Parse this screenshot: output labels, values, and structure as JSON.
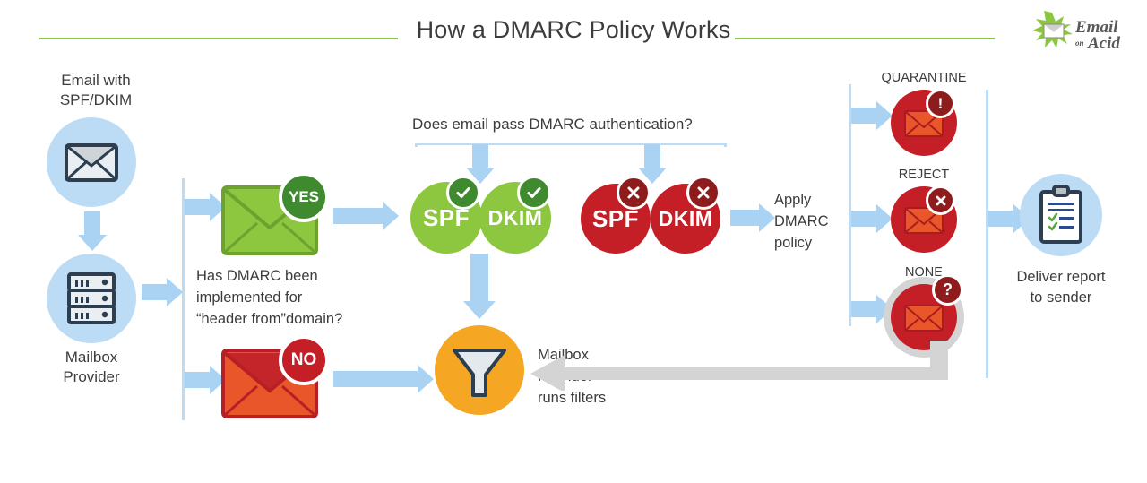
{
  "header": {
    "title": "How a DMARC Policy Works",
    "logo_line1": "Email",
    "logo_line2": "on",
    "logo_line3": "Acid"
  },
  "colors": {
    "green_rule": "#8cc63e",
    "blue_light": "#bcdcf5",
    "blue_arrow": "#a9d2f3",
    "blue_circle": "#bcdcf5",
    "green_pass": "#8dc63f",
    "green_badge": "#3f8a2e",
    "red_fail": "#c41e26",
    "red_badge": "#8f1c1c",
    "orange_env": "#e8562a",
    "amber": "#f5a623",
    "gray_arrow": "#d4d4d4",
    "text": "#3c3c3b",
    "navy": "#2c3e50"
  },
  "start": {
    "label_line1": "Email with",
    "label_line2": "SPF/DKIM",
    "icon": "envelope-icon"
  },
  "provider": {
    "label_line1": "Mailbox",
    "label_line2": "Provider",
    "icon": "server-rack-icon"
  },
  "decision": {
    "question_line1": "Has DMARC been",
    "question_line2": "implemented for",
    "question_line3": "“header from”domain?",
    "yes_label": "YES",
    "no_label": "NO"
  },
  "auth": {
    "question": "Does email pass DMARC authentication?",
    "pass": [
      {
        "label": "SPF",
        "badge": "check-icon"
      },
      {
        "label": "DKIM",
        "badge": "check-icon"
      }
    ],
    "fail": [
      {
        "label": "SPF",
        "badge": "x-icon"
      },
      {
        "label": "DKIM",
        "badge": "x-icon"
      }
    ]
  },
  "filters": {
    "label_line1": "Mailbox",
    "label_line2": "Provider",
    "label_line3": "runs filters",
    "icon": "funnel-icon"
  },
  "apply": {
    "line1": "Apply",
    "line2": "DMARC",
    "line3": "policy"
  },
  "policies": [
    {
      "label": "QUARANTINE",
      "badge": "exclamation-icon",
      "highlighted": false
    },
    {
      "label": "REJECT",
      "badge": "x-icon",
      "highlighted": false
    },
    {
      "label": "NONE",
      "badge": "question-icon",
      "highlighted": true
    }
  ],
  "report": {
    "label_line1": "Deliver report",
    "label_line2": "to sender",
    "icon": "clipboard-check-icon"
  }
}
